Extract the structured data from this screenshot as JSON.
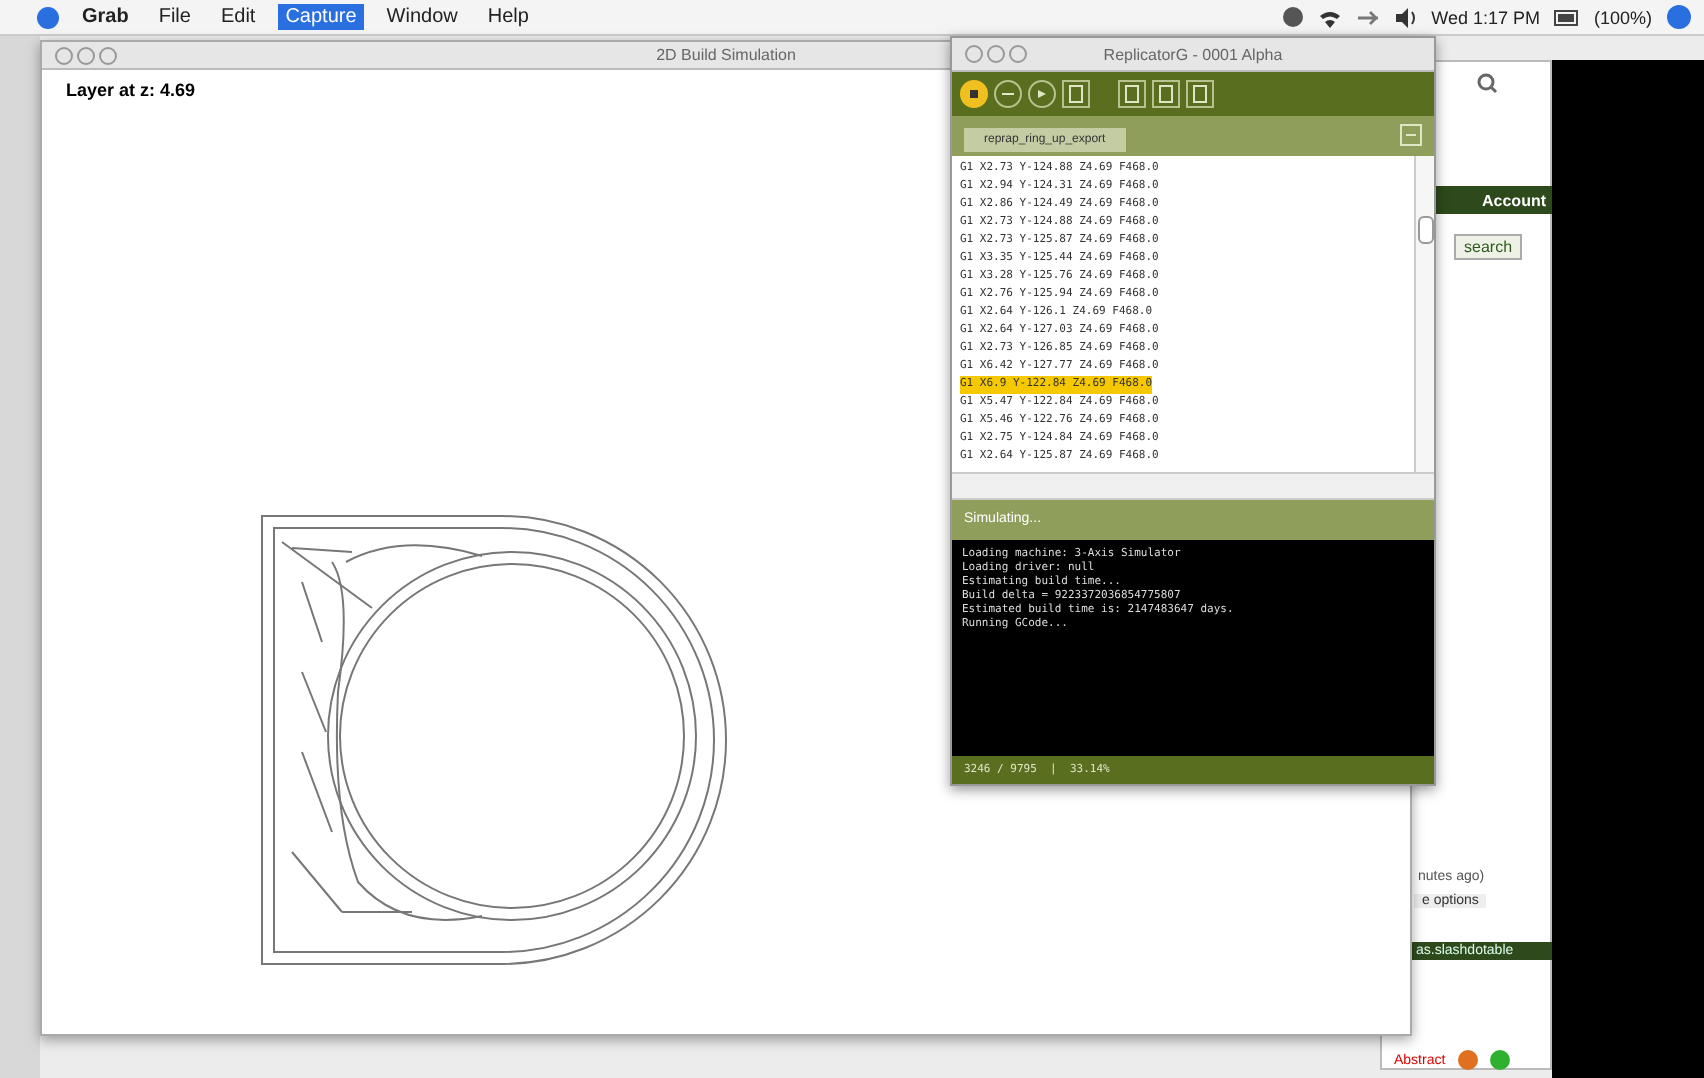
{
  "menubar": {
    "app_menus": [
      {
        "label": "Grab",
        "selected": false
      },
      {
        "label": "File",
        "selected": false
      },
      {
        "label": "Edit",
        "selected": false
      },
      {
        "label": "Capture",
        "selected": true
      },
      {
        "label": "Window",
        "selected": false
      },
      {
        "label": "Help",
        "selected": false
      }
    ],
    "clock": "Wed 1:17 PM",
    "battery": "(100%)"
  },
  "main_window": {
    "title": "2D Build Simulation",
    "layer_label": "Layer at z: 4.69"
  },
  "replicator": {
    "title": "ReplicatorG - 0001 Alpha",
    "toolbar": [
      {
        "kind": "stop",
        "selected": true
      },
      {
        "kind": "pause",
        "selected": false
      },
      {
        "kind": "play",
        "selected": false
      },
      {
        "kind": "doc",
        "selected": false
      },
      {
        "kind": "doc",
        "selected": false
      },
      {
        "kind": "doc",
        "selected": false
      },
      {
        "kind": "doc",
        "selected": false
      }
    ],
    "tab": "reprap_ring_up_export",
    "gcode": [
      {
        "text": "G1 X2.73 Y-124.88 Z4.69 F468.0",
        "selected": false
      },
      {
        "text": "G1 X2.94 Y-124.31 Z4.69 F468.0",
        "selected": false
      },
      {
        "text": "G1 X2.86 Y-124.49 Z4.69 F468.0",
        "selected": false
      },
      {
        "text": "G1 X2.73 Y-124.88 Z4.69 F468.0",
        "selected": false
      },
      {
        "text": "G1 X2.73 Y-125.87 Z4.69 F468.0",
        "selected": false
      },
      {
        "text": "G1 X3.35 Y-125.44 Z4.69 F468.0",
        "selected": false
      },
      {
        "text": "G1 X3.28 Y-125.76 Z4.69 F468.0",
        "selected": false
      },
      {
        "text": "G1 X2.76 Y-125.94 Z4.69 F468.0",
        "selected": false
      },
      {
        "text": "G1 X2.64 Y-126.1 Z4.69 F468.0",
        "selected": false
      },
      {
        "text": "G1 X2.64 Y-127.03 Z4.69 F468.0",
        "selected": false
      },
      {
        "text": "G1 X2.73 Y-126.85 Z4.69 F468.0",
        "selected": false
      },
      {
        "text": "G1 X6.42 Y-127.77 Z4.69 F468.0",
        "selected": false
      },
      {
        "text": "G1 X6.9 Y-122.84 Z4.69 F468.0",
        "selected": true
      },
      {
        "text": "G1 X5.47 Y-122.84 Z4.69 F468.0",
        "selected": false
      },
      {
        "text": "G1 X5.46 Y-122.76 Z4.69 F468.0",
        "selected": false
      },
      {
        "text": "G1 X2.75 Y-124.84 Z4.69 F468.0",
        "selected": false
      },
      {
        "text": "G1 X2.64 Y-125.87 Z4.69 F468.0",
        "selected": false
      }
    ],
    "console_header": "Simulating...",
    "console": [
      "Loading machine: 3-Axis Simulator",
      "Loading driver: null",
      "Estimating build time...",
      "Build delta = 9223372036854775807",
      "Estimated build time is: 2147483647 days.",
      "Running GCode..."
    ],
    "status": "3246 / 9795  |  33.14%"
  },
  "browser": {
    "account": "Account",
    "search": "search",
    "ago": "nutes ago)",
    "options": "e options",
    "link": "as.slashdotable",
    "abstract": "Abstract"
  }
}
